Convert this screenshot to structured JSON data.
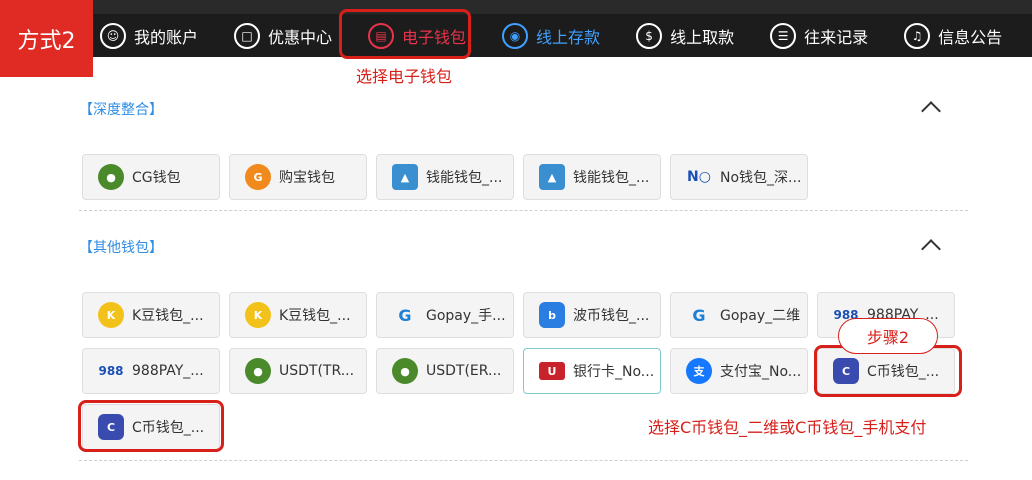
{
  "method_badge": "方式2",
  "nav": [
    {
      "label": "我的账户",
      "icon": "user-icon"
    },
    {
      "label": "优惠中心",
      "icon": "gift-icon"
    },
    {
      "label": "电子钱包",
      "icon": "wallet-icon"
    },
    {
      "label": "线上存款",
      "icon": "deposit-icon"
    },
    {
      "label": "线上取款",
      "icon": "withdraw-icon"
    },
    {
      "label": "往来记录",
      "icon": "records-icon"
    },
    {
      "label": "信息公告",
      "icon": "bell-icon"
    }
  ],
  "annotations": {
    "select_wallet": "选择电子钱包",
    "step": "步骤2",
    "select_c_wallet": "选择C币钱包_二维或C币钱包_手机支付"
  },
  "sections": [
    {
      "title": "【深度整合】",
      "items": [
        {
          "label": "CG钱包",
          "icon": "cg-wallet-icon"
        },
        {
          "label": "购宝钱包",
          "icon": "goubao-icon"
        },
        {
          "label": "钱能钱包_...",
          "icon": "qianneng-icon"
        },
        {
          "label": "钱能钱包_...",
          "icon": "qianneng-icon"
        },
        {
          "label": "No钱包_深...",
          "icon": "no-wallet-icon"
        }
      ]
    },
    {
      "title": "【其他钱包】",
      "items": [
        {
          "label": "K豆钱包_...",
          "icon": "kdou-icon"
        },
        {
          "label": "K豆钱包_...",
          "icon": "kdou-icon"
        },
        {
          "label": "Gopay_手...",
          "icon": "gopay-icon"
        },
        {
          "label": "波币钱包_...",
          "icon": "bobi-icon"
        },
        {
          "label": "Gopay_二维",
          "icon": "gopay-icon"
        },
        {
          "label": "988PAY_...",
          "icon": "pay988-icon"
        },
        {
          "label": "988PAY_...",
          "icon": "pay988-icon"
        },
        {
          "label": "USDT(TR...",
          "icon": "usdt-icon"
        },
        {
          "label": "USDT(ER...",
          "icon": "usdt-icon"
        },
        {
          "label": "银行卡_No...",
          "icon": "unionpay-icon"
        },
        {
          "label": "支付宝_No...",
          "icon": "alipay-icon"
        },
        {
          "label": "C币钱包_...",
          "icon": "cbi-icon"
        },
        {
          "label": "C币钱包_...",
          "icon": "cbi-icon"
        }
      ]
    }
  ],
  "colors": {
    "accent_red": "#d8201b",
    "link_blue": "#2f8de4",
    "nav_bg": "#1c1c1c"
  }
}
